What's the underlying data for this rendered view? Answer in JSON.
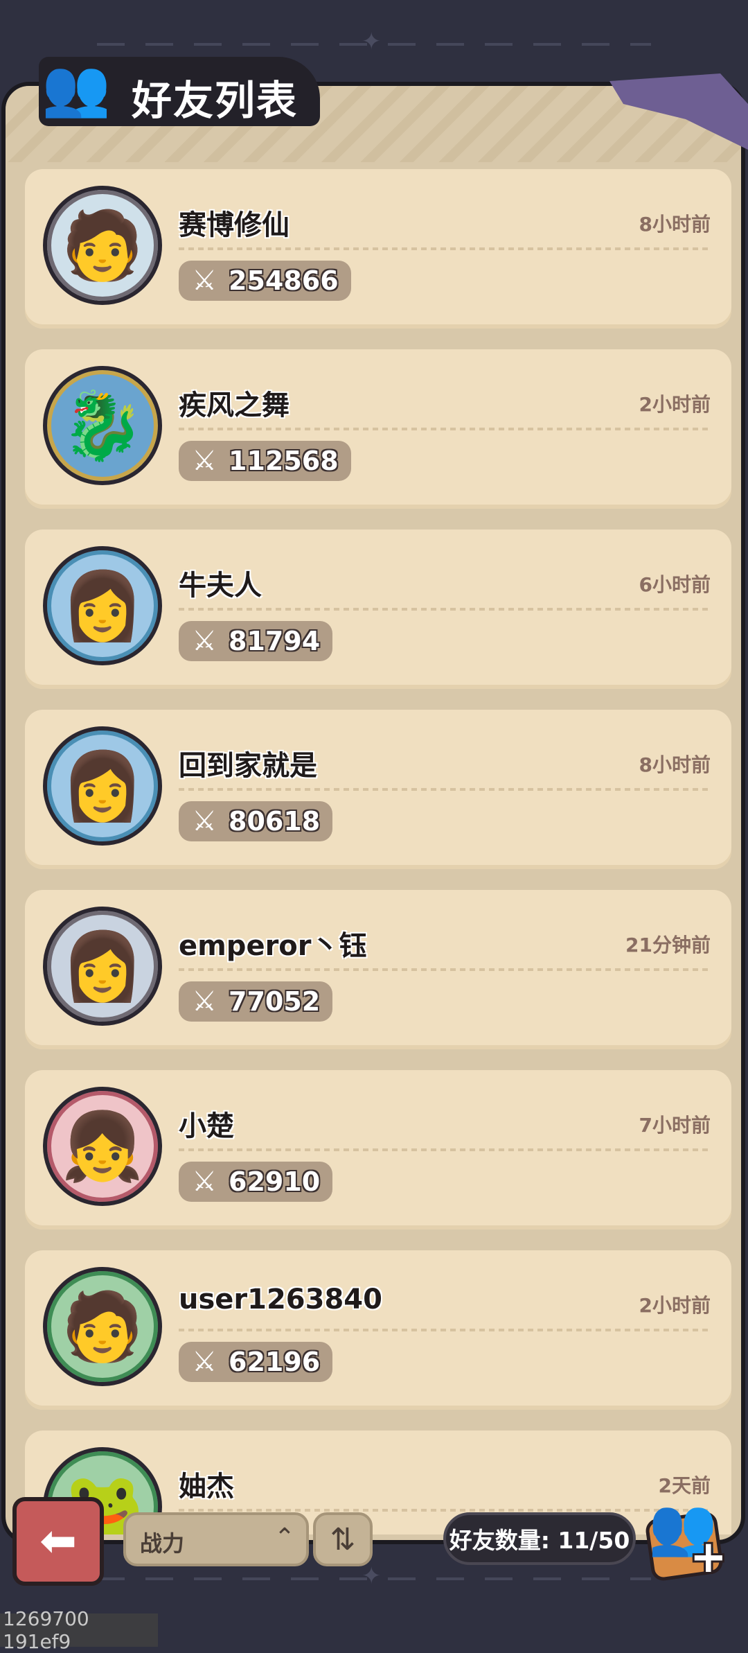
{
  "header": {
    "title": "好友列表"
  },
  "friends": [
    {
      "name": "赛博修仙",
      "time": "8小时前",
      "power": "254866",
      "ring": "#6f6a73",
      "bg": "#cfe0ea",
      "face": "🧑"
    },
    {
      "name": "疾风之舞",
      "time": "2小时前",
      "power": "112568",
      "ring": "#c7a64b",
      "bg": "#6aa4cf",
      "face": "🐉"
    },
    {
      "name": "牛夫人",
      "time": "6小时前",
      "power": "81794",
      "ring": "#4a8fb5",
      "bg": "#9ec8e6",
      "face": "👩"
    },
    {
      "name": "回到家就是",
      "time": "8小时前",
      "power": "80618",
      "ring": "#4a8fb5",
      "bg": "#9ec8e6",
      "face": "👩"
    },
    {
      "name": "emperor丶钰",
      "time": "21分钟前",
      "power": "77052",
      "ring": "#6f6a73",
      "bg": "#c9d3e0",
      "face": "👩"
    },
    {
      "name": "小楚",
      "time": "7小时前",
      "power": "62910",
      "ring": "#b55a6a",
      "bg": "#efc4c8",
      "face": "👧"
    },
    {
      "name": "user1263840",
      "time": "2小时前",
      "power": "62196",
      "ring": "#3f8d55",
      "bg": "#9fd0a6",
      "face": "🧑"
    },
    {
      "name": "妯杰",
      "time": "2天前",
      "power": "",
      "ring": "#3f8d55",
      "bg": "#9fd0a6",
      "face": "🐸"
    }
  ],
  "toolbar": {
    "sort_label": "战力",
    "friend_count": "好友数量: 11/50"
  },
  "debug_text": "1269700 191ef9",
  "icons": {
    "power": "sword-shield-icon",
    "back": "back-arrow-icon",
    "add_friend": "add-friend-icon",
    "sort_order": "sort-order-icon",
    "caret": "caret-up-icon"
  }
}
